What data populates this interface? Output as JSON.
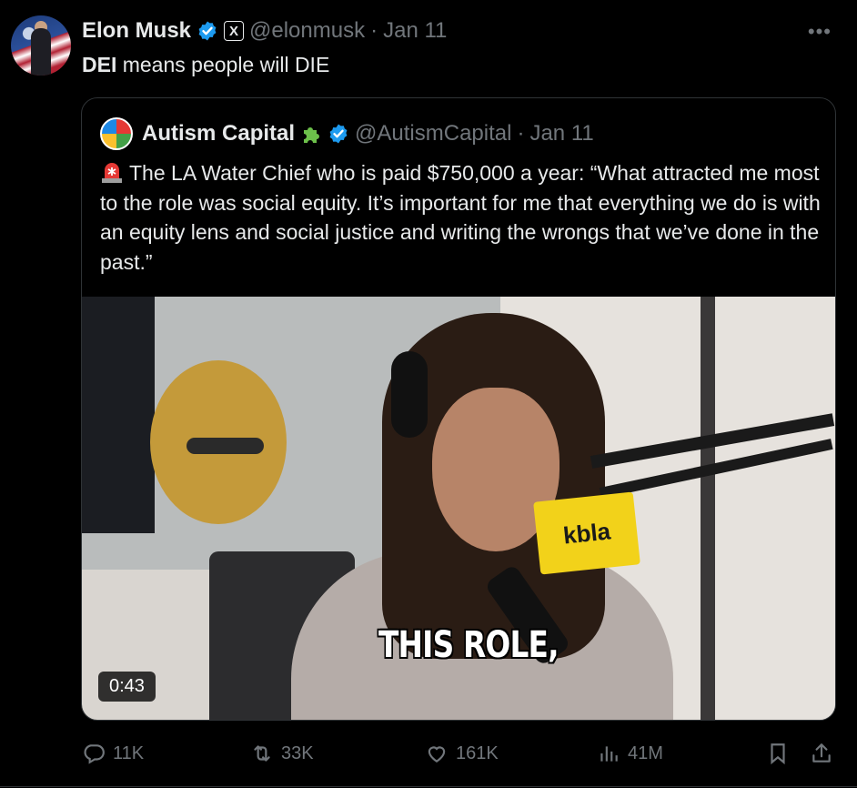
{
  "author": {
    "name": "Elon Musk",
    "handle": "@elonmusk",
    "separator": "·",
    "date": "Jan 11",
    "verified_icon": "verified-badge-icon",
    "affiliate_badge": "X"
  },
  "tweet": {
    "text_bold": "DEI",
    "text_rest": " means people will DIE"
  },
  "quoted": {
    "name": "Autism Capital",
    "handle": "@AutismCapital",
    "separator": "·",
    "date": "Jan 11",
    "badge_icons": [
      "puzzle-piece-icon",
      "verified-badge-icon"
    ],
    "text": "The LA Water Chief who is paid $750,000 a year: “What attracted me most to the role was social equity. It’s important for me that everything we do is with an equity lens and social justice and writing the wrongs that we’ve done in the past.”",
    "video": {
      "caption": "THIS ROLE,",
      "mic_flag": "kbla",
      "duration": "0:43"
    }
  },
  "actions": {
    "replies": "11K",
    "reposts": "33K",
    "likes": "161K",
    "views": "41M"
  },
  "colors": {
    "background": "#000000",
    "text": "#e7e9ea",
    "muted": "#71767b",
    "verified": "#1d9bf0",
    "border": "#2f3336"
  }
}
